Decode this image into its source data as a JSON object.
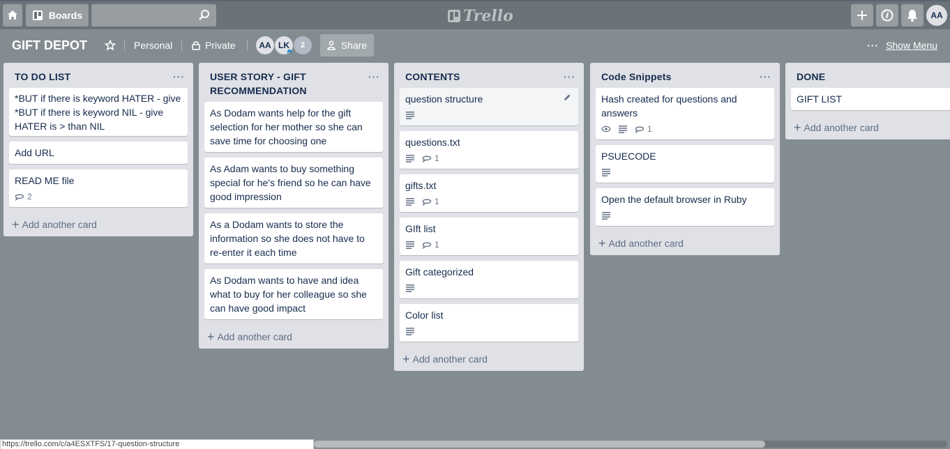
{
  "nav": {
    "boards_label": "Boards",
    "logo_text": "Trello",
    "avatar_initials": "AA"
  },
  "board": {
    "title": "GIFT DEPOT",
    "visibility_team": "Personal",
    "visibility_private": "Private",
    "members": [
      "AA",
      "LK"
    ],
    "member_extra_count": "2",
    "share_label": "Share",
    "show_menu_label": "Show Menu"
  },
  "lists": [
    {
      "title": "TO DO LIST",
      "cards": [
        {
          "title": "*BUT if there is keyword HATER - give *BUT if there is keyword NIL - give HATER is > than NIL"
        },
        {
          "title": "Add URL"
        },
        {
          "title": "READ ME file",
          "comments": "2"
        }
      ],
      "add_label": "Add another card"
    },
    {
      "title": "USER STORY - GIFT RECOMMENDATION",
      "cards": [
        {
          "title": "As Dodam wants help for the gift selection for her mother so she can save time for choosing one"
        },
        {
          "title": "As Adam wants to buy something special for he's friend so he can have good impression"
        },
        {
          "title": "As a Dodam wants to store the information so she does not have to re-enter it each time"
        },
        {
          "title": "As Dodam wants to have and idea what to buy for her colleague so she can have good impact"
        }
      ],
      "add_label": "Add another card"
    },
    {
      "title": "CONTENTS",
      "cards": [
        {
          "title": "question structure"
        },
        {
          "title": "questions.txt",
          "comments": "1"
        },
        {
          "title": "gifts.txt",
          "comments": "1"
        },
        {
          "title": "GIft list",
          "comments": "1"
        },
        {
          "title": "Gift categorized"
        },
        {
          "title": "Color list"
        }
      ],
      "add_label": "Add another card"
    },
    {
      "title": "Code Snippets",
      "cards": [
        {
          "title": "Hash created for questions and answers",
          "comments": "1"
        },
        {
          "title": "PSUECODE"
        },
        {
          "title": "Open the default browser in Ruby"
        }
      ],
      "add_label": "Add another card"
    },
    {
      "title": "DONE",
      "cards": [
        {
          "title": "GIFT LIST"
        }
      ],
      "add_label": "Add another card"
    }
  ],
  "status_url": "https://trello.com/c/a4ESXTFS/17-question-structure"
}
